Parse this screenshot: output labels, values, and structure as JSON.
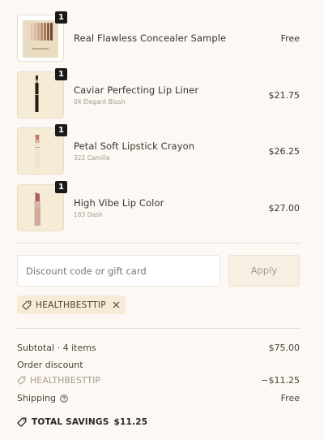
{
  "items": [
    {
      "name": "Real Flawless Concealer Sample",
      "variant": "",
      "price": "Free",
      "qty": "1"
    },
    {
      "name": "Caviar Perfecting Lip Liner",
      "variant": "04 Elegant Blush",
      "price": "$21.75",
      "qty": "1"
    },
    {
      "name": "Petal Soft Lipstick Crayon",
      "variant": "322 Camille",
      "price": "$26.25",
      "qty": "1"
    },
    {
      "name": "High Vibe Lip Color",
      "variant": "183 Dash",
      "price": "$27.00",
      "qty": "1"
    }
  ],
  "discount": {
    "placeholder": "Discount code or gift card",
    "apply_label": "Apply"
  },
  "applied_code": {
    "code": "HEALTHBESTTIP"
  },
  "summary": {
    "subtotal_label": "Subtotal · 4 items",
    "subtotal_value": "$75.00",
    "order_discount_label": "Order discount",
    "discount_code": "HEALTHBESTTIP",
    "discount_value": "−$11.25",
    "shipping_label": "Shipping",
    "shipping_value": "Free",
    "total_savings_label": "TOTAL SAVINGS",
    "total_savings_value": "$11.25"
  }
}
